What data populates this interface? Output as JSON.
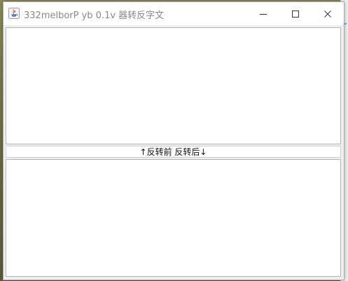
{
  "window": {
    "title": "332melborP yb 0.1v 器转反字文"
  },
  "controls": {
    "minimize": "minimize",
    "maximize": "maximize",
    "close": "close"
  },
  "editor": {
    "top_text": "",
    "bottom_text": "",
    "divider_label": "↑反转前 反转后↓"
  },
  "colors": {
    "title_text": "#888888",
    "accent_icon": "#2b6fc7"
  }
}
